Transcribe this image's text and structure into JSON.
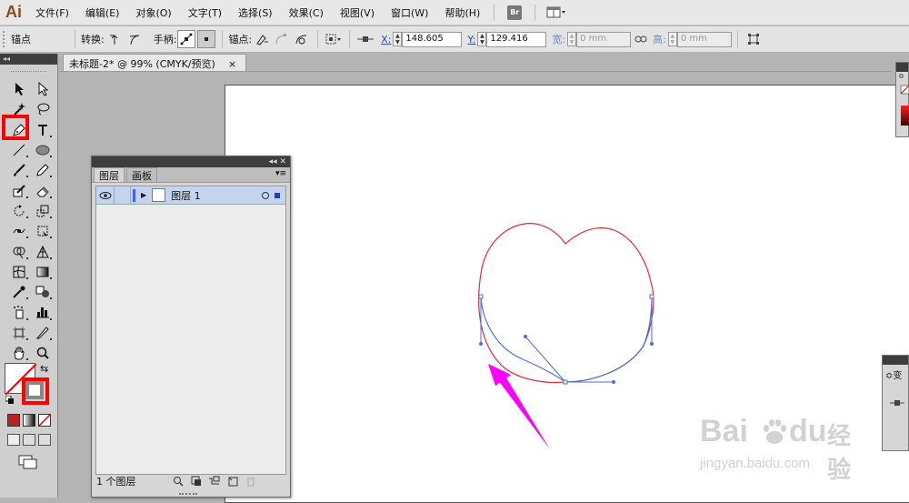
{
  "app": {
    "logo": "Ai"
  },
  "menubar": {
    "items": [
      "文件(F)",
      "编辑(E)",
      "对象(O)",
      "文字(T)",
      "选择(S)",
      "效果(C)",
      "视图(V)",
      "窗口(W)",
      "帮助(H)"
    ],
    "bridge_label": "Br"
  },
  "control_bar": {
    "selection_label": "锚点",
    "convert_label": "转换:",
    "handles_label": "手柄:",
    "anchor_label": "锚点:",
    "x_label": "X:",
    "x_value": "148.605",
    "y_label": "Y:",
    "y_value": "129.416",
    "w_label": "宽:",
    "w_value": "0 mm",
    "h_label": "高:",
    "h_value": "0 mm"
  },
  "document": {
    "tab_title": "未标题-2* @ 99% (CMYK/预览)",
    "tab_close": "×"
  },
  "layers_panel": {
    "tabs": [
      "图层",
      "画板"
    ],
    "layers": [
      {
        "name": "图层 1"
      }
    ],
    "footer_count": "1 个图层"
  },
  "right_panel2": {
    "tab_label": "≎变"
  },
  "watermark": {
    "brand": "Bai",
    "brand2": "du",
    "brand_cn": "经验",
    "url": "jingyan.baidu.com"
  },
  "colors": {
    "path_red": "#e0303a",
    "path_blue": "#4a6fd8",
    "highlight_red": "#ff0000",
    "arrow_magenta": "#ff00ff"
  }
}
